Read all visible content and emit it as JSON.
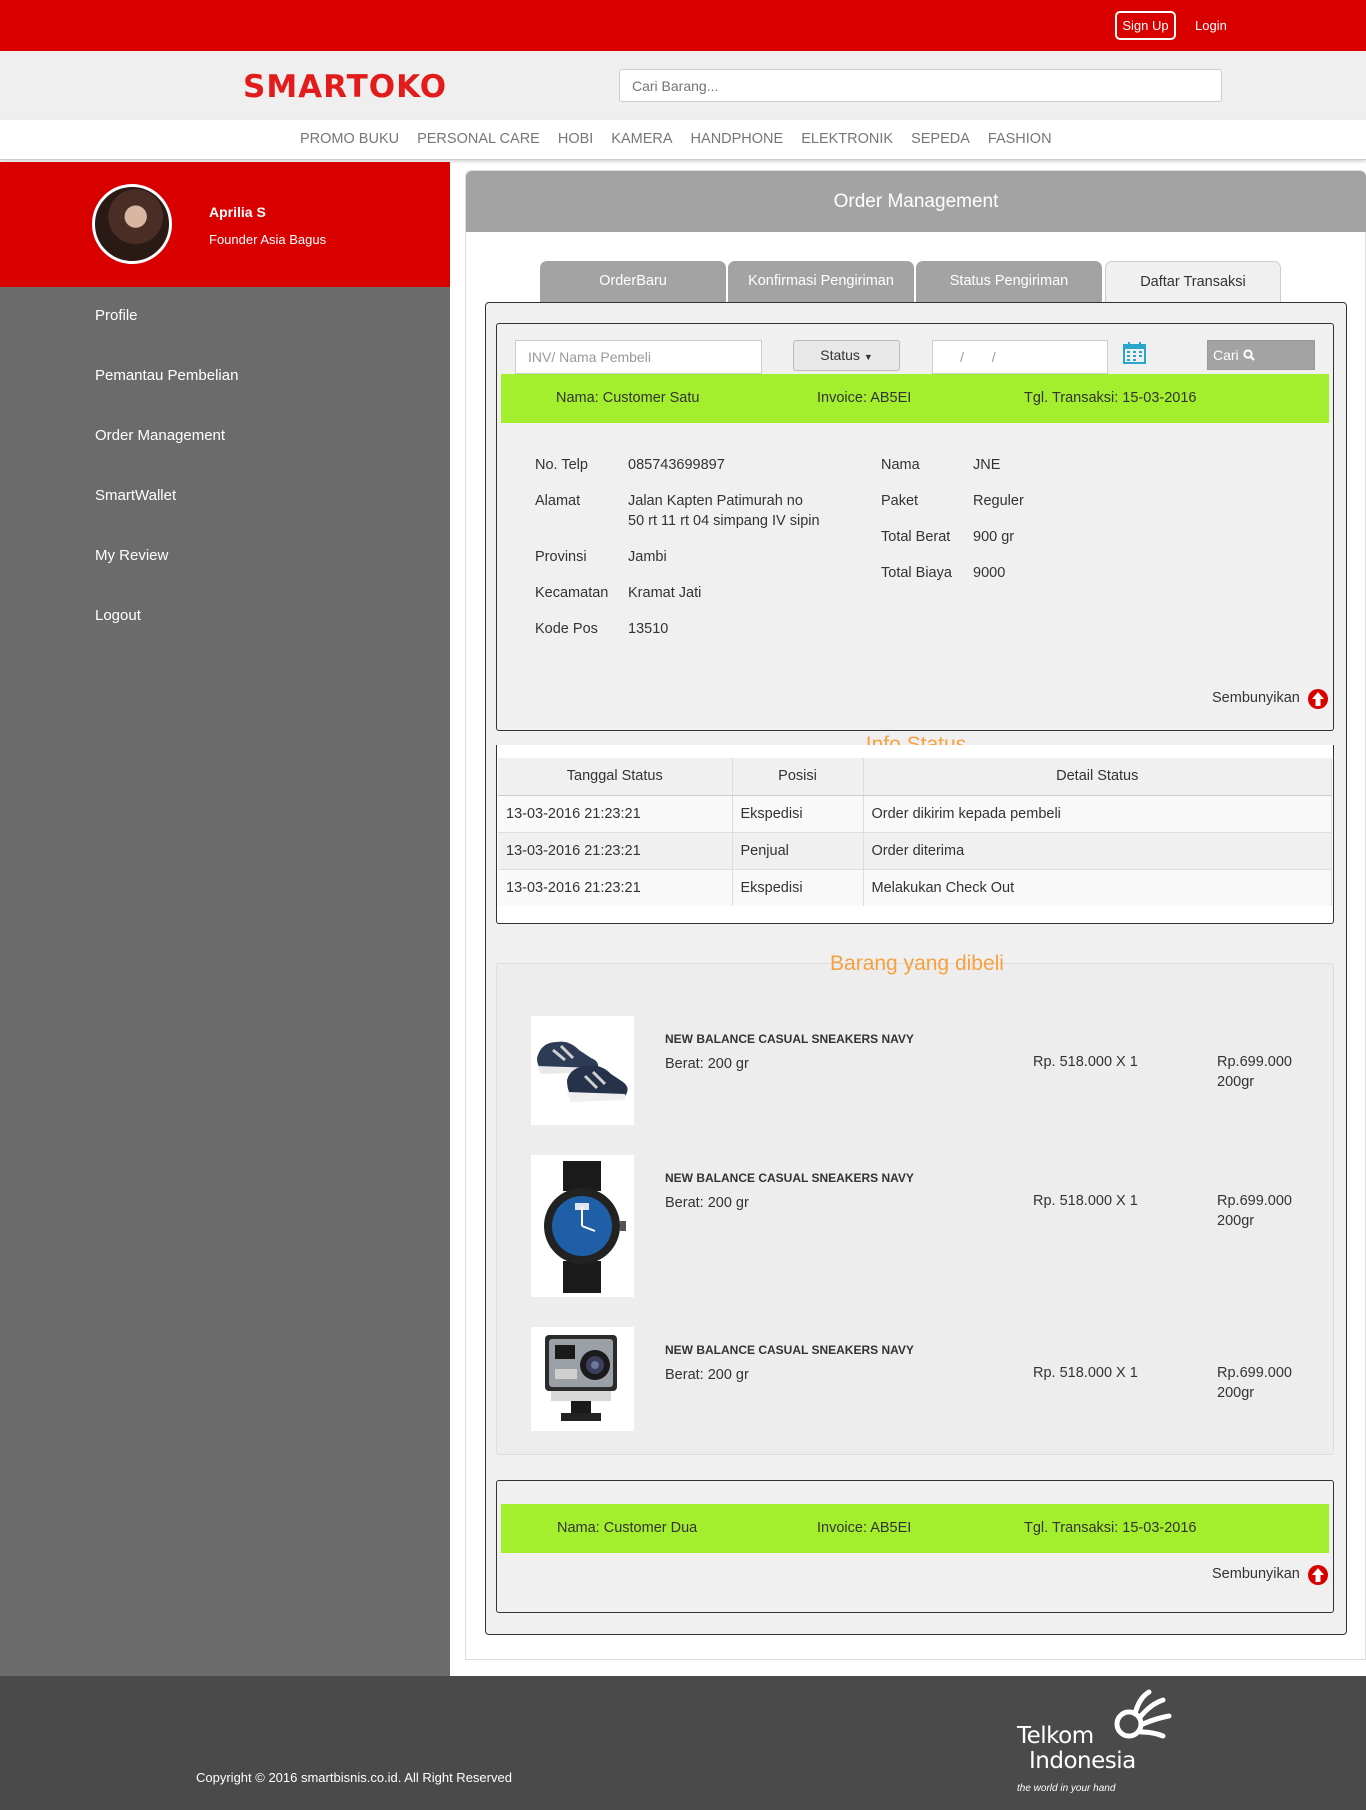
{
  "topbar": {
    "signup_label": "Sign Up",
    "login_label": "Login"
  },
  "header": {
    "logo": "SMARTOKO",
    "search_placeholder": "Cari Barang..."
  },
  "categories": [
    "PROMO BUKU",
    "PERSONAL CARE",
    "HOBI",
    "KAMERA",
    "HANDPHONE",
    "ELEKTRONIK",
    "SEPEDA",
    "FASHION"
  ],
  "profile": {
    "name": "Aprilia S",
    "role": "Founder Asia Bagus"
  },
  "sidebar_menu": [
    "Profile",
    "Pemantau Pembelian",
    "Order Management",
    "SmartWallet",
    "My Review",
    "Logout"
  ],
  "panel_title": "Order Management",
  "tabs": [
    {
      "label": "OrderBaru",
      "active": false
    },
    {
      "label": "Konfirmasi Pengiriman",
      "active": false
    },
    {
      "label": "Status Pengiriman",
      "active": false
    },
    {
      "label": "Daftar Transaksi",
      "active": true
    }
  ],
  "filter": {
    "inv_placeholder": "INV/ Nama Pembeli",
    "status_label": "Status",
    "date_value": "/ /",
    "search_label": "Cari"
  },
  "order1": {
    "name": "Nama: Customer Satu",
    "invoice": "Invoice: AB5EI",
    "date": "Tgl. Transaksi: 15-03-2016",
    "details_left": [
      {
        "label": "No. Telp",
        "value": "085743699897"
      },
      {
        "label": "Alamat",
        "value_line1": "Jalan Kapten Patimurah no",
        "value_line2": "50 rt 11 rt 04 simpang IV sipin"
      },
      {
        "label": "Provinsi",
        "value": "Jambi"
      },
      {
        "label": "Kecamatan",
        "value": "Kramat Jati"
      },
      {
        "label": "Kode Pos",
        "value": "13510"
      }
    ],
    "details_right": [
      {
        "label": "Nama",
        "value": "JNE"
      },
      {
        "label": "Paket",
        "value": "Reguler"
      },
      {
        "label": "Total Berat",
        "value": "900 gr"
      },
      {
        "label": "Total Biaya",
        "value": "9000"
      }
    ],
    "hide_label": "Sembunyikan"
  },
  "info_status": {
    "title": "Info Status",
    "headers": [
      "Tanggal Status",
      "Posisi",
      "Detail Status"
    ],
    "rows": [
      [
        "13-03-2016 21:23:21",
        "Ekspedisi",
        "Order dikirim kepada pembeli"
      ],
      [
        "13-03-2016 21:23:21",
        "Penjual",
        "Order diterima"
      ],
      [
        "13-03-2016 21:23:21",
        "Ekspedisi",
        "Melakukan Check Out"
      ]
    ]
  },
  "purchased": {
    "title": "Barang yang dibeli",
    "items": [
      {
        "name": "NEW BALANCE CASUAL SNEAKERS NAVY",
        "weight": "Berat: 200 gr",
        "price": "Rp. 518.000 X 1",
        "total": "Rp.699.000",
        "total_weight": "200gr",
        "icon": "sneakers-image"
      },
      {
        "name": "NEW BALANCE CASUAL SNEAKERS NAVY",
        "weight": "Berat: 200 gr",
        "price": "Rp. 518.000 X 1",
        "total": "Rp.699.000",
        "total_weight": "200gr",
        "icon": "watch-image"
      },
      {
        "name": "NEW BALANCE CASUAL SNEAKERS NAVY",
        "weight": "Berat: 200 gr",
        "price": "Rp. 518.000 X 1",
        "total": "Rp.699.000",
        "total_weight": "200gr",
        "icon": "action-camera-image"
      }
    ]
  },
  "order2": {
    "name": "Nama: Customer Dua",
    "invoice": "Invoice: AB5EI",
    "date": "Tgl. Transaksi: 15-03-2016",
    "hide_label": "Sembunyikan"
  },
  "footer": {
    "copyright": "Copyright © 2016 smartbisnis.co.id. All Right Reserved",
    "brand_line1": "Telkom",
    "brand_line2": "Indonesia",
    "tagline": "the world in your hand"
  },
  "colors": {
    "brand_red": "#d90000",
    "accent_green": "#a3ef2e",
    "section_orange": "#f6a140",
    "sidebar_gray": "#6b6b6b"
  }
}
